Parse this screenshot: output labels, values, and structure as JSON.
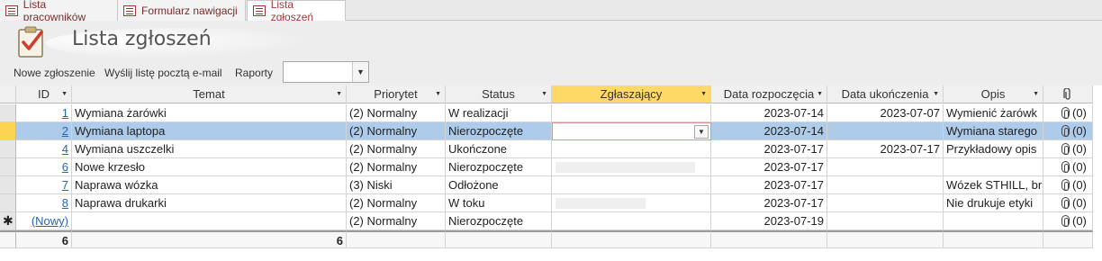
{
  "tabs": [
    {
      "label": "Lista pracowników"
    },
    {
      "label": "Formularz nawigacji"
    },
    {
      "label": "Lista zgłoszeń"
    }
  ],
  "form": {
    "title": "Lista zgłoszeń"
  },
  "toolbar": {
    "new_label": "Nowe zgłoszenie",
    "email_label": "Wyślij listę pocztą e-mail",
    "reports_label": "Raporty",
    "reports_value": ""
  },
  "columns": [
    "ID",
    "Temat",
    "Priorytet",
    "Status",
    "Zgłaszający",
    "Data rozpoczęcia",
    "Data ukończenia",
    "Opis"
  ],
  "rows": [
    {
      "id": "1",
      "temat": "Wymiana żarówki",
      "priorytet": "(2) Normalny",
      "status": "W realizacji",
      "zglaszajacy": "",
      "start": "2023-07-14",
      "koniec": "2023-07-07",
      "opis": "Wymienić żarówk",
      "zal": "(0)"
    },
    {
      "id": "2",
      "temat": "Wymiana laptopa",
      "priorytet": "(2) Normalny",
      "status": "Nierozpoczęte",
      "zglaszajacy": "",
      "start": "2023-07-14",
      "koniec": "",
      "opis": "Wymiana starego",
      "zal": "(0)"
    },
    {
      "id": "4",
      "temat": "Wymiana uszczelki",
      "priorytet": "(2) Normalny",
      "status": "Ukończone",
      "zglaszajacy": "",
      "start": "2023-07-17",
      "koniec": "2023-07-17",
      "opis": "Przykładowy opis",
      "zal": "(0)"
    },
    {
      "id": "6",
      "temat": "Nowe krzesło",
      "priorytet": "(2) Normalny",
      "status": "Nierozpoczęte",
      "zglaszajacy": "",
      "start": "2023-07-17",
      "koniec": "",
      "opis": "",
      "zal": "(0)"
    },
    {
      "id": "7",
      "temat": "Naprawa wózka",
      "priorytet": "(3) Niski",
      "status": "Odłożone",
      "zglaszajacy": "",
      "start": "2023-07-17",
      "koniec": "",
      "opis": "Wózek STHILL, bra",
      "zal": "(0)"
    },
    {
      "id": "8",
      "temat": "Naprawa drukarki",
      "priorytet": "(2) Normalny",
      "status": "W toku",
      "zglaszajacy": "",
      "start": "2023-07-17",
      "koniec": "",
      "opis": "Nie drukuje etyki",
      "zal": "(0)"
    }
  ],
  "new_row": {
    "id": "(Nowy)",
    "priorytet": "(2) Normalny",
    "status": "Nierozpoczęte",
    "start": "2023-07-19",
    "zal": "(0)",
    "marker": "✱"
  },
  "totals": {
    "id_count": "6",
    "temat_count": "6"
  },
  "icons": {
    "tab_icon": "form-icon",
    "header_icon": "clipboard-check-icon",
    "attachment_icon": "paperclip-icon",
    "dropdown_icon": "chevron-down-icon"
  },
  "colors": {
    "current_row": "#aecbea",
    "selected_column": "#ffd966",
    "row_selector_current": "#fcd353",
    "accent": "#a4373a"
  }
}
